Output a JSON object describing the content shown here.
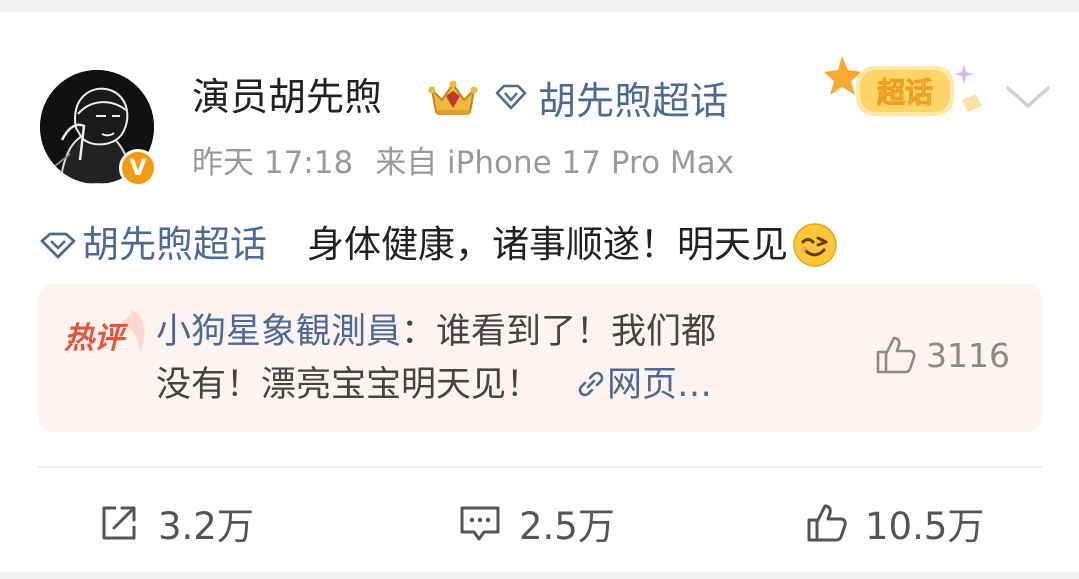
{
  "post": {
    "author": {
      "name": "演员胡先煦",
      "avatar_icon": "avatar-image",
      "verified_icon": "verified-v-icon",
      "verified_letter": "V",
      "crown_icon": "crown-icon"
    },
    "topic_chip": {
      "label": "胡先煦超话",
      "icon": "diamond-icon"
    },
    "super_topic_badge": {
      "label": "超话",
      "icon": "super-topic-badge"
    },
    "more_icon": "chevron-down-icon",
    "time": "昨天 17:18",
    "source": "来自 iPhone 17 Pro Max",
    "content": {
      "topic": "胡先煦超话",
      "text": "身体健康，诸事顺遂！明天见",
      "emoji": "wink-emoji"
    },
    "hot_comment": {
      "label": "热评",
      "user": "小狗星象観測員",
      "separator": "：",
      "text_line1": "谁看到了！我们都",
      "text_line2": "没有！漂亮宝宝明天见！",
      "link_label": "网页…",
      "like_count": "3116"
    },
    "actions": {
      "repost": "3.2万",
      "comment": "2.5万",
      "like": "10.5万"
    },
    "colors": {
      "link_blue": "#4b6a9a",
      "hot_bg": "#fdf3f0",
      "hot_red": "#e8533a",
      "verified_orange": "#f59a12"
    }
  }
}
